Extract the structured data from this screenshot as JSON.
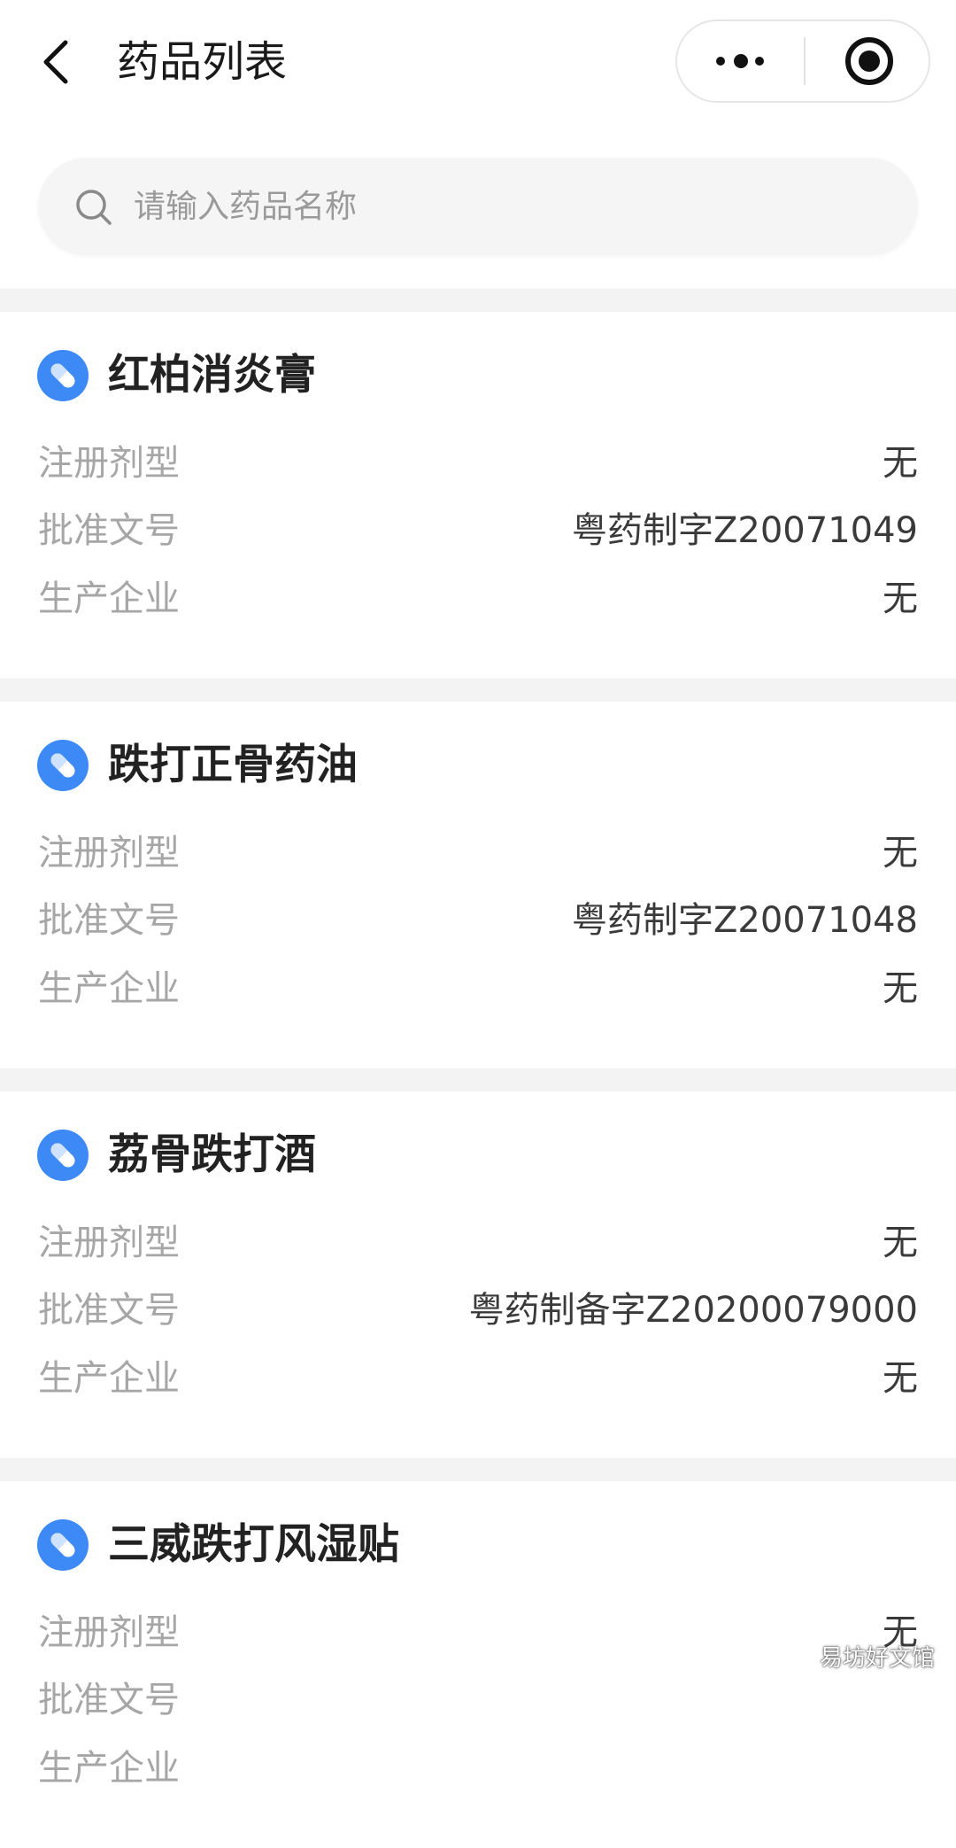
{
  "header": {
    "title": "药品列表",
    "back_icon": "chevron-left-icon",
    "more_icon": "more-dots-icon",
    "close_icon": "target-circle-icon"
  },
  "search": {
    "placeholder": "请输入药品名称",
    "value": "",
    "icon": "search-icon"
  },
  "drugs": [
    {
      "name": "红柏消炎膏",
      "fields": [
        {
          "label": "注册剂型",
          "value": "无"
        },
        {
          "label": "批准文号",
          "value": "粤药制字Z20071049"
        },
        {
          "label": "生产企业",
          "value": "无"
        }
      ]
    },
    {
      "name": "跌打正骨药油",
      "fields": [
        {
          "label": "注册剂型",
          "value": "无"
        },
        {
          "label": "批准文号",
          "value": "粤药制字Z20071048"
        },
        {
          "label": "生产企业",
          "value": "无"
        }
      ]
    },
    {
      "name": "荔骨跌打酒",
      "fields": [
        {
          "label": "注册剂型",
          "value": "无"
        },
        {
          "label": "批准文号",
          "value": "粤药制备字Z20200079000"
        },
        {
          "label": "生产企业",
          "value": "无"
        }
      ]
    },
    {
      "name": "三威跌打风湿贴",
      "fields": [
        {
          "label": "注册剂型",
          "value": "无"
        },
        {
          "label": "批准文号",
          "value": ""
        },
        {
          "label": "生产企业",
          "value": ""
        }
      ]
    }
  ],
  "colors": {
    "pill_icon_bg": "#3d8af7",
    "page_background": "#f3f3f3"
  },
  "watermark": "易坊好文馆"
}
